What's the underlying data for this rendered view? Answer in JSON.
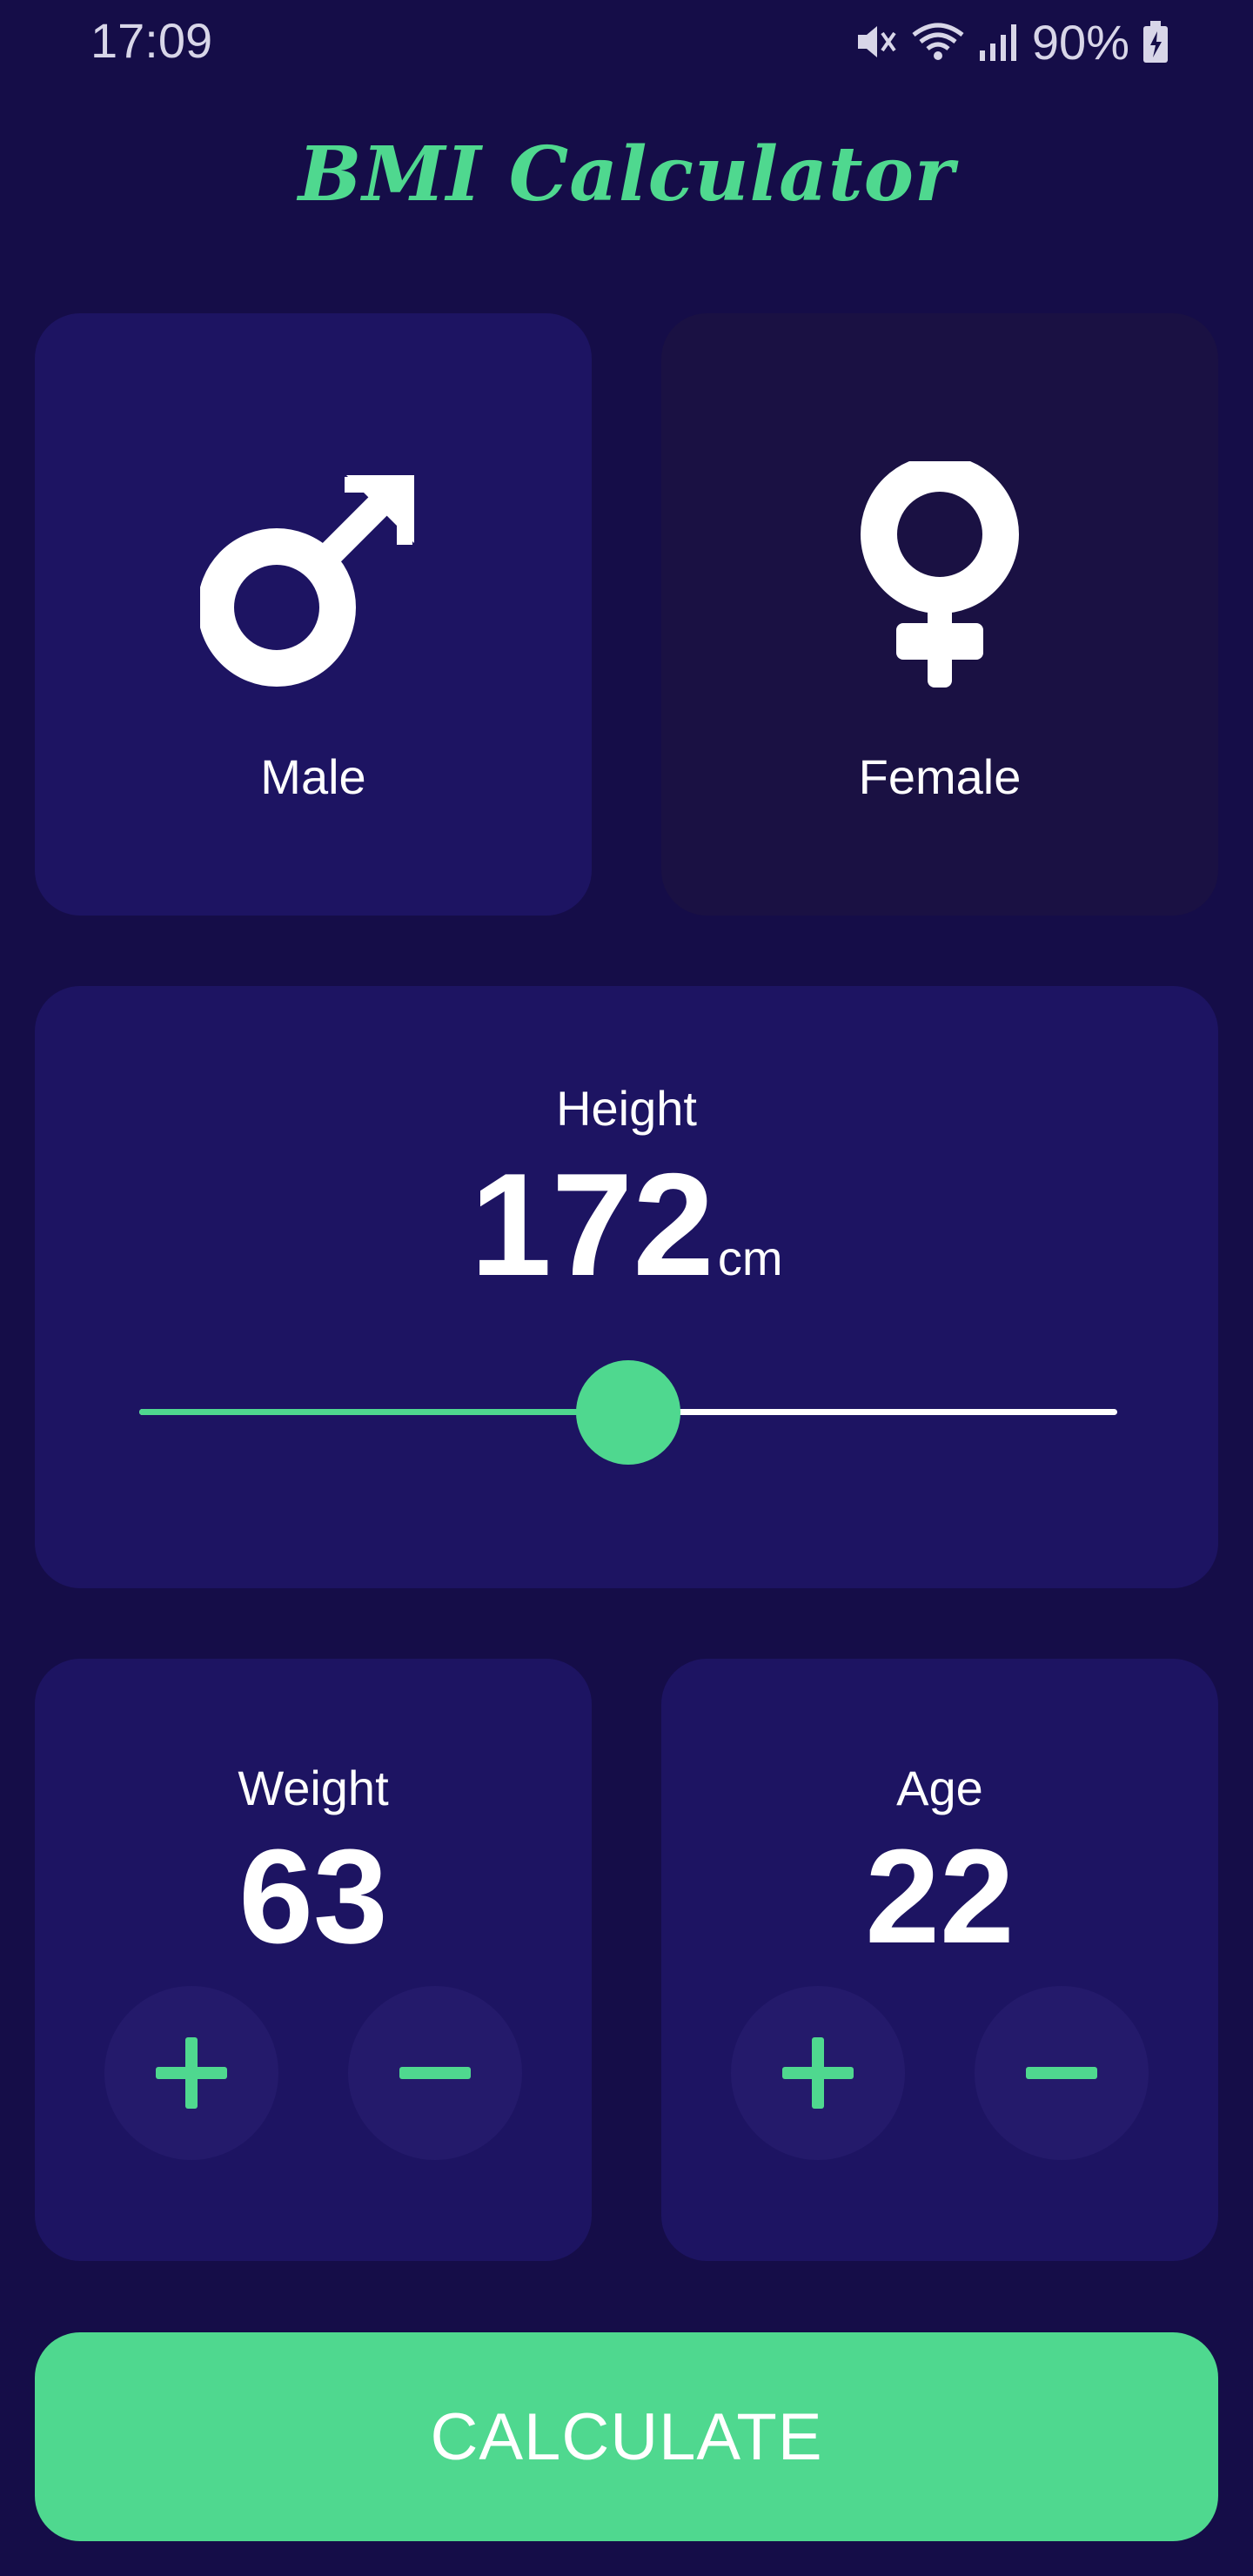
{
  "status_bar": {
    "time": "17:09",
    "battery_percent": "90%",
    "icons": [
      "mute-icon",
      "wifi-icon",
      "signal-icon",
      "battery-charging-icon"
    ]
  },
  "app": {
    "title": "BMI Calculator"
  },
  "gender": {
    "male_label": "Male",
    "female_label": "Female",
    "selected": "male"
  },
  "height": {
    "label": "Height",
    "value": "172",
    "unit": "cm",
    "slider_fraction": 0.5
  },
  "weight": {
    "label": "Weight",
    "value": "63"
  },
  "age": {
    "label": "Age",
    "value": "22"
  },
  "calculate_label": "CALCULATE",
  "colors": {
    "background": "#150d48",
    "card_active": "#1d1462",
    "card_inactive": "#1a1143",
    "accent": "#4fd88f",
    "text": "#ffffff"
  }
}
